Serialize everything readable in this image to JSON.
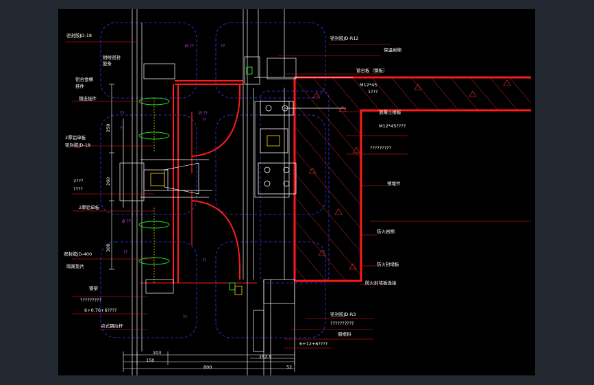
{
  "colors": {
    "background": "#000000",
    "frame": "#212830",
    "wall": "#ff1a1a",
    "line": "#ffffff",
    "hatch": "#ff3333",
    "blueDashed": "#3a3aff",
    "glassGreen": "#22dd22",
    "magenta": "#d040ff",
    "yellow": "#ffdd00"
  },
  "labels": {
    "l1": "密封胶JD-18",
    "l2": "耐候密封",
    "l3": "胶条",
    "l4": "铝合金横",
    "l5": "挂件",
    "l6": "钢连接件",
    "l7": "2厚铝单板",
    "l8": "密封胶JD-18",
    "l9": "2???",
    "l10": "????",
    "l11": "2厚铝单板",
    "l12": "密封胶JD-400",
    "l13": "隔离垫片",
    "l14": "钢架",
    "l15": "?????????",
    "l16": "6+0.76+6????",
    "l17": "点式钢拉杆",
    "r1": "密封胶JD-R12",
    "r2": "保温岩棉",
    "r3": "窗台板（钢板）",
    "r4": "M12*45",
    "r5": "1???",
    "r6": "混凝土楼板",
    "r7": "M12*45????",
    "r8": "?????????",
    "r9": "预埋件",
    "r10": "防火岩棉",
    "r11": "防火封堵板",
    "r12": "防火封堵板连接",
    "r13": "密封胶JD-R3",
    "r14": "??????????",
    "r15": "窗框料",
    "r16": "6+12+6????"
  },
  "magentaNotes": {
    "m1": "Ø ??",
    "m2": "??",
    "m3": "??",
    "m4": "??",
    "m5": "Ø ??",
    "m6": "??",
    "m7": "Ø ??",
    "m8": "??",
    "m9": "??",
    "m10": "??"
  },
  "dimensions": {
    "d1": "250",
    "d2": "260",
    "d3": "300",
    "d4": "103",
    "d5": "150",
    "d6": "600",
    "d7": "152.5",
    "d8": "52"
  }
}
